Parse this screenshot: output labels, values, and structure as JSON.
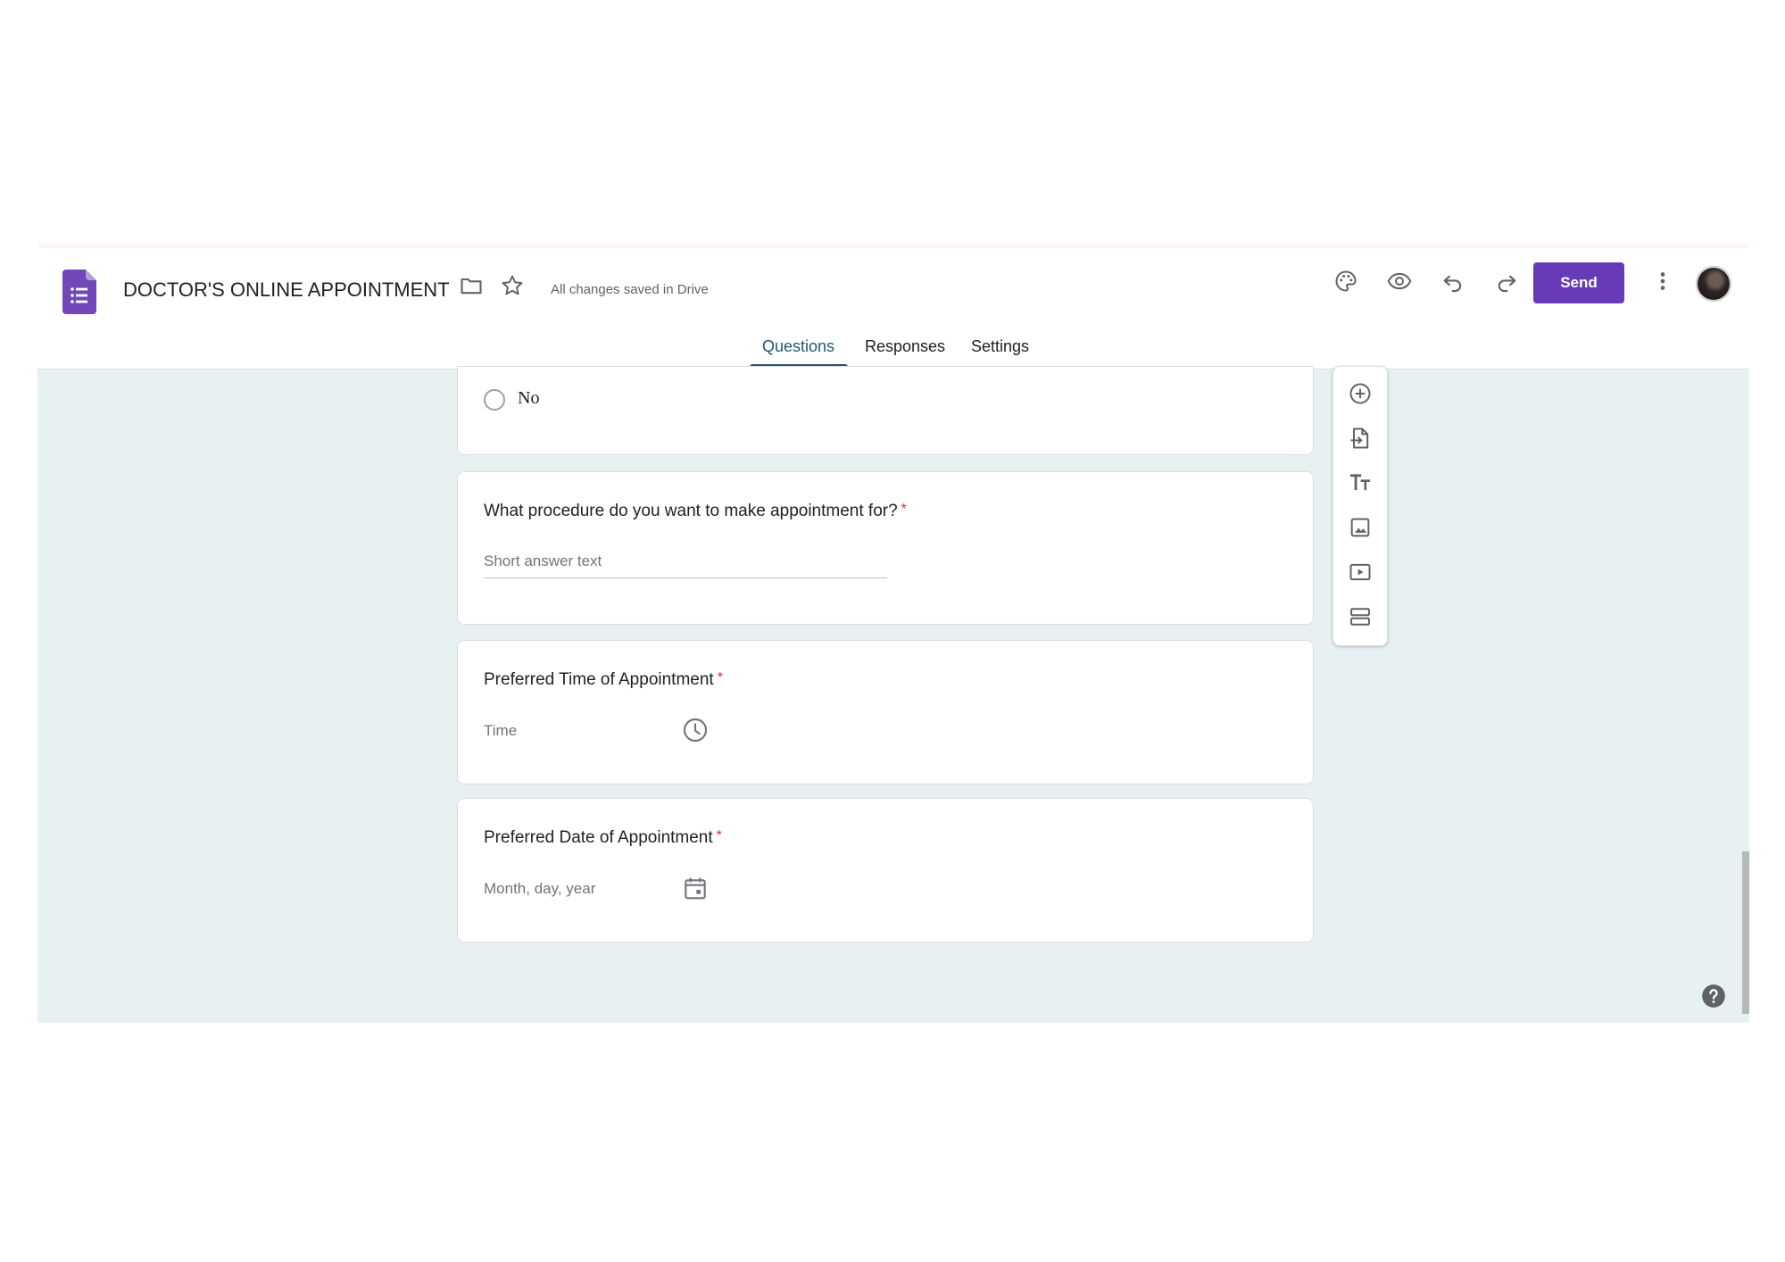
{
  "header": {
    "title": "DOCTOR'S ONLINE APPOINTMENT",
    "saved_status": "All changes saved in Drive",
    "send_label": "Send",
    "icons": [
      "forms-logo-icon",
      "folder-icon",
      "star-icon",
      "palette-icon",
      "preview-eye-icon",
      "undo-icon",
      "redo-icon",
      "more-vert-icon"
    ]
  },
  "tabs": [
    {
      "label": "Questions",
      "active": true
    },
    {
      "label": "Responses",
      "active": false
    },
    {
      "label": "Settings",
      "active": false
    }
  ],
  "questions": {
    "prev_option": {
      "label": "No"
    },
    "procedure": {
      "title": "What procedure do you want to make appointment for?",
      "required_mark": "*",
      "placeholder": "Short answer text"
    },
    "time": {
      "title": "Preferred Time of Appointment",
      "required_mark": "*",
      "field_text": "Time",
      "icon": "clock-icon"
    },
    "date": {
      "title": "Preferred Date of Appointment",
      "required_mark": "*",
      "field_text": "Month, day, year",
      "icon": "calendar-icon"
    }
  },
  "toolbar": {
    "items": [
      "add-question-icon",
      "import-questions-icon",
      "add-title-icon",
      "add-image-icon",
      "add-video-icon",
      "add-section-icon"
    ]
  },
  "colors": {
    "accent": "#673ab7",
    "tab_active": "#20596d",
    "background": "#e7f1f2",
    "required": "#d93025"
  }
}
